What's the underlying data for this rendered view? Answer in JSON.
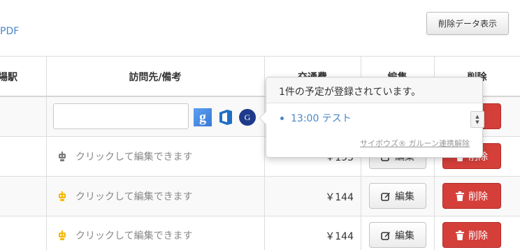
{
  "top": {
    "pdf_link": "PDF",
    "show_deleted_label": "削除データ表示"
  },
  "table": {
    "headers": {
      "station": "場駅",
      "visit": "訪問先/備考",
      "fare": "交通費",
      "edit": "編集",
      "delete": "削除"
    },
    "placeholder_text": "クリックして編集できます",
    "rows": [
      {
        "fare": "￥195",
        "robot_color": "#777777"
      },
      {
        "fare": "￥144",
        "robot_color": "#f5b800"
      },
      {
        "fare": "￥144",
        "robot_color": "#f5b800"
      }
    ],
    "edit_label": "編集",
    "delete_label": "削除",
    "first_row_delete_label": "削除"
  },
  "services": {
    "google": "g",
    "office": "office-icon",
    "garoon": "G"
  },
  "popover": {
    "title": "1件の予定が登録されています。",
    "items": [
      {
        "label": "13:00 テスト"
      }
    ],
    "unlink_label": "サイボウズ® ガルーン連携解除"
  },
  "colors": {
    "link": "#4a86c5",
    "danger": "#d43f3a",
    "robot_gray": "#777777",
    "robot_yellow": "#f5b800"
  }
}
